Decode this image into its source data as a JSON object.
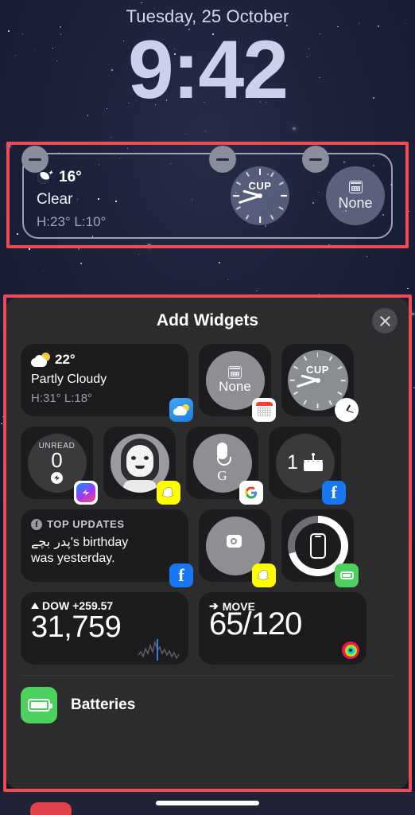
{
  "lock_screen": {
    "date": "Tuesday, 25 October",
    "time": "9:42"
  },
  "widget_tray": {
    "weather": {
      "icon": "moon-stars-icon",
      "temperature": "16°",
      "condition": "Clear",
      "high_low": "H:23° L:10°"
    },
    "clock": {
      "icon": "analog-clock-icon",
      "label": "CUP"
    },
    "calendar": {
      "icon": "calendar-icon",
      "label": "None"
    },
    "remove_badges": [
      "remove-widget-1",
      "remove-widget-2",
      "remove-widget-3"
    ]
  },
  "panel": {
    "title": "Add Widgets",
    "close_icon": "close-icon",
    "rows": [
      {
        "weather": {
          "icon": "sun-cloud-icon",
          "temperature": "22°",
          "condition": "Partly Cloudy",
          "high_low": "H:31° L:18°",
          "badge": "weather-app-icon"
        },
        "calendar": {
          "icon": "calendar-icon",
          "label": "None",
          "badge": "calendar-app-icon"
        },
        "clock": {
          "label": "CUP",
          "badge": "clock-app-icon"
        }
      },
      {
        "messenger": {
          "label": "UNREAD",
          "count": "0",
          "badge": "messenger-app-icon"
        },
        "snapchat_avatar": {
          "icon": "bitmoji-avatar-icon",
          "badge": "snapchat-app-icon"
        },
        "google": {
          "icon": "microphone-icon",
          "letter": "G",
          "badge": "google-app-icon"
        },
        "facebook_birthday": {
          "count": "1",
          "icon": "birthday-cake-icon",
          "badge": "facebook-app-icon"
        }
      },
      {
        "facebook_updates": {
          "header": "TOP UPDATES",
          "line1_name": "پدر بچے",
          "line1_rest": "'s birthday",
          "line2": "was yesterday.",
          "badge": "facebook-app-icon"
        },
        "snapchat_camera": {
          "icon": "snapchat-camera-icon",
          "badge": "snapchat-app-icon"
        },
        "batteries": {
          "icon": "phone-battery-ring-icon",
          "badge": "batteries-app-icon"
        }
      },
      {
        "stocks": {
          "symbol": "DOW",
          "change": "+259.57",
          "value": "31,759",
          "badge": "stocks-app-icon"
        },
        "fitness": {
          "label": "MOVE",
          "value": "65/120",
          "badge": "fitness-rings-icon"
        }
      }
    ],
    "list_item": {
      "label": "Batteries",
      "icon": "batteries-app-icon"
    }
  },
  "colors": {
    "annotation": "#f04a54",
    "panel_bg": "#2c2c2e",
    "card_bg": "#1c1c1e",
    "accent_green": "#4cd05e",
    "facebook_blue": "#1877f2",
    "snapchat_yellow": "#fffc00",
    "clock_time": "#ccd0ea"
  }
}
